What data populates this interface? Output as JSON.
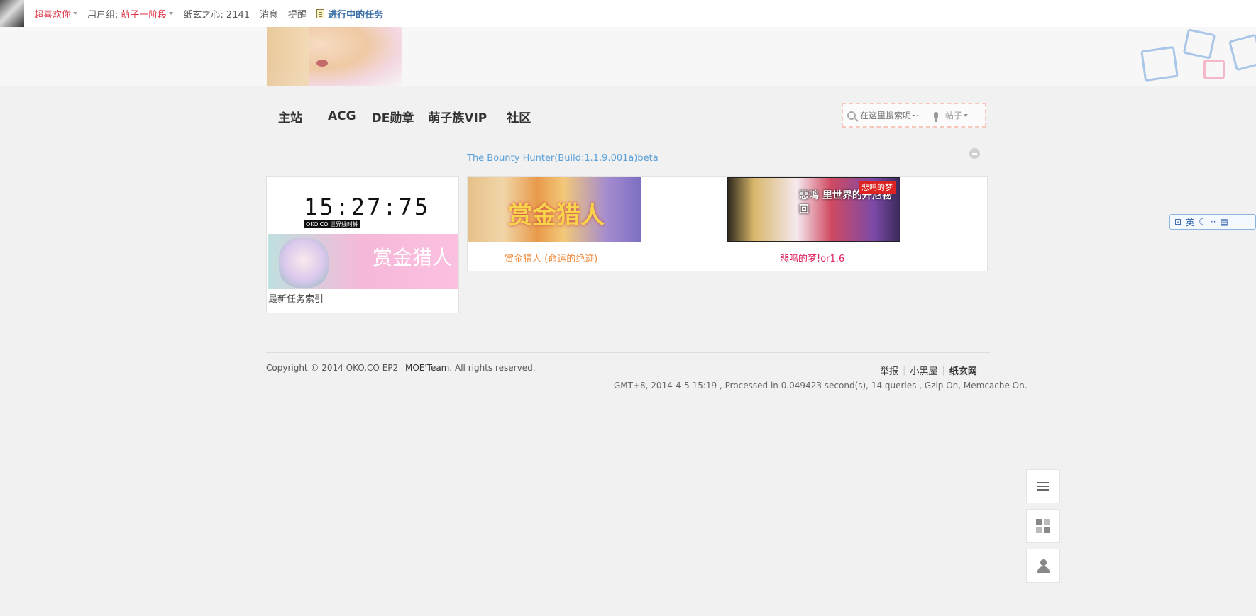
{
  "topbar": {
    "welcome": "超喜欢你",
    "usergroup_label": "用户组:",
    "usergroup_value": "萌子一阶段",
    "points": "纸玄之心: 2141",
    "messages": "消息",
    "reminders": "提醒",
    "tasks": "进行中的任务"
  },
  "nav": {
    "items": [
      "主站",
      "ACG",
      "DE勋章",
      "萌子族VIP",
      "社区"
    ]
  },
  "search": {
    "placeholder": "在这里搜索呢~",
    "type": "帖子"
  },
  "content": {
    "game_title": "The Bounty Hunter(Build:1.1.9.001a)beta",
    "clock": "15:27:75",
    "clock_sub": "OKO.CO 世界线时钟",
    "left_banner_text": "赏金猎人",
    "left_caption": "最新任务索引",
    "games": [
      {
        "thumb_text": "赏金猎人",
        "name": "赏金猎人 (命运的绝迹)"
      },
      {
        "thumb_text": "悲鸣 里世界的开尼物回",
        "tag": "悲鸣的梦",
        "name": "悲鸣的梦!or1.6"
      }
    ]
  },
  "footer": {
    "copyright": "Copyright © 2014 OKO.CO EP2",
    "team": "MOE'Team.",
    "rights": "All rights reserved.",
    "links": [
      "举报",
      "小黑屋",
      "纸玄网"
    ],
    "processed": "GMT+8, 2014-4-5 15:19 , Processed in 0.049423 second(s), 14 queries , Gzip On, Memcache On."
  },
  "ime": {
    "lang": "英"
  }
}
